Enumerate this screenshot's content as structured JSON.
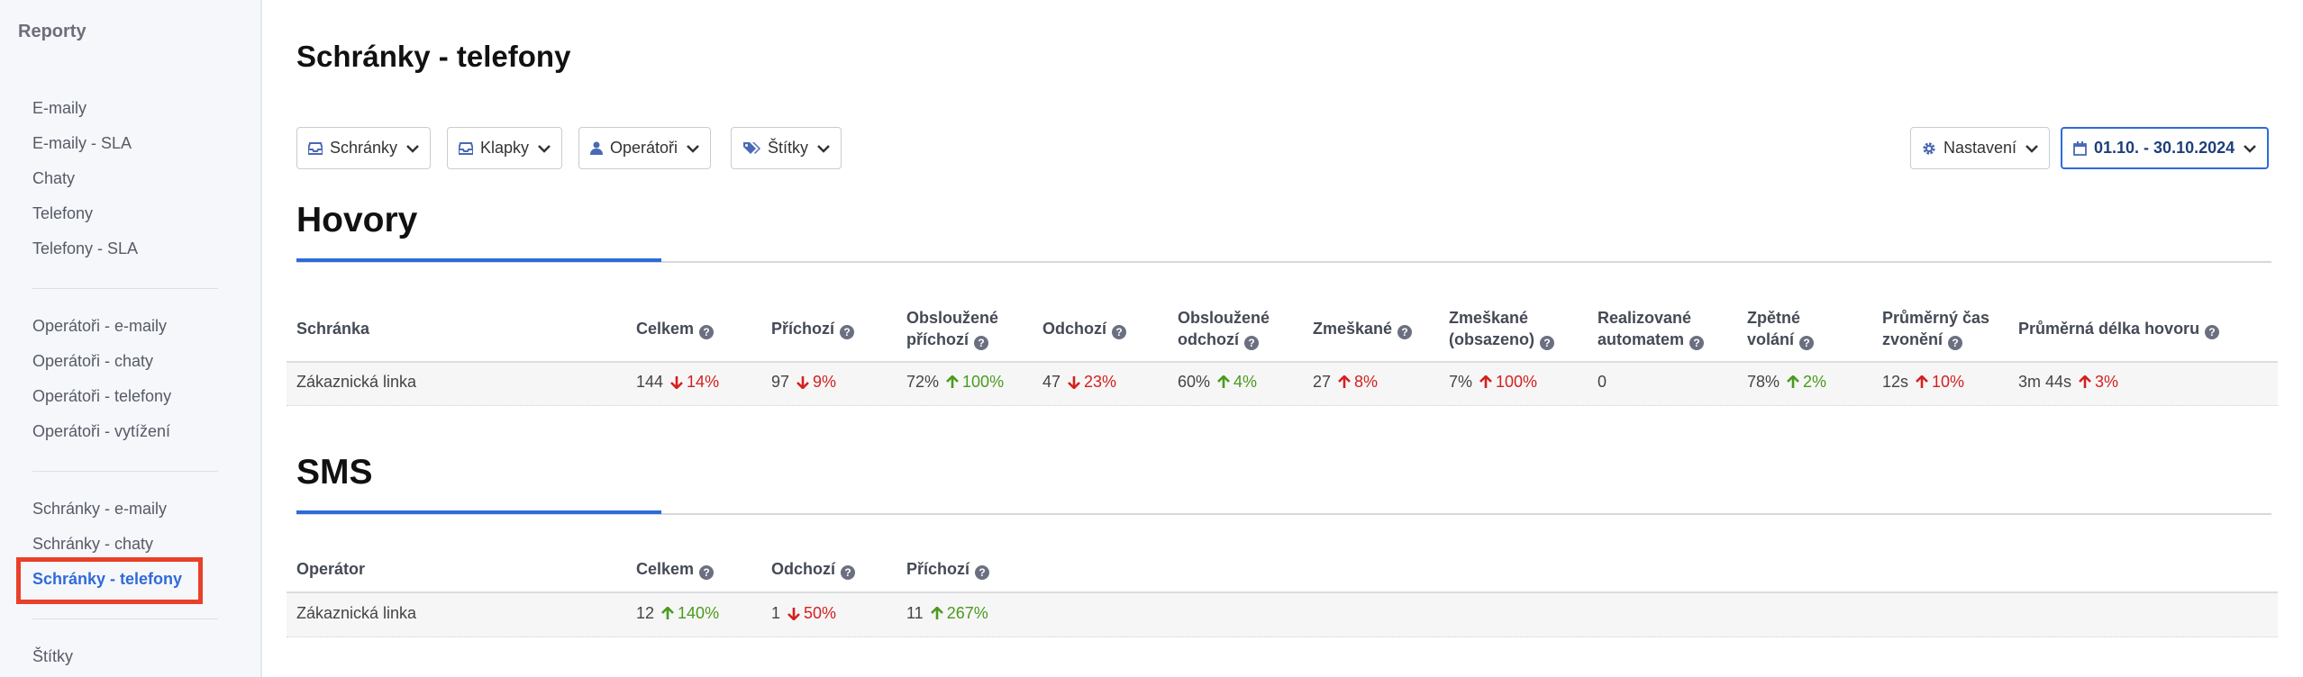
{
  "sidebar": {
    "title": "Reporty",
    "groups": [
      [
        "E-maily",
        "E-maily - SLA",
        "Chaty",
        "Telefony",
        "Telefony - SLA"
      ],
      [
        "Operátoři - e-maily",
        "Operátoři - chaty",
        "Operátoři - telefony",
        "Operátoři - vytížení"
      ],
      [
        "Schránky - e-maily",
        "Schránky - chaty",
        "Schránky - telefony"
      ],
      [
        "Štítky"
      ]
    ],
    "active": "Schránky - telefony"
  },
  "page": {
    "title": "Schránky - telefony"
  },
  "filters": {
    "mailboxes": "Schránky",
    "extensions": "Klapky",
    "operators": "Operátoři",
    "tags": "Štítky",
    "settings": "Nastavení",
    "date_range": "01.10. - 30.10.2024"
  },
  "calls": {
    "title": "Hovory",
    "headers": [
      "Schránka",
      "Celkem",
      "Příchozí",
      "Obsloužené příchozí",
      "Odchozí",
      "Obsloužené odchozí",
      "Zmeškané",
      "Zmeškané (obsazeno)",
      "Realizované automatem",
      "Zpětné volání",
      "Průměrný čas zvonění",
      "Průměrná délka hovoru"
    ],
    "row": {
      "name": "Zákaznická linka",
      "cells": [
        {
          "value": "144",
          "change": "14%",
          "trend": "down"
        },
        {
          "value": "97",
          "change": "9%",
          "trend": "down"
        },
        {
          "value": "72%",
          "change": "100%",
          "trend": "up"
        },
        {
          "value": "47",
          "change": "23%",
          "trend": "down"
        },
        {
          "value": "60%",
          "change": "4%",
          "trend": "up"
        },
        {
          "value": "27",
          "change": "8%",
          "trend": "upbad"
        },
        {
          "value": "7%",
          "change": "100%",
          "trend": "upbad"
        },
        {
          "value": "0",
          "change": "",
          "trend": ""
        },
        {
          "value": "78%",
          "change": "2%",
          "trend": "up"
        },
        {
          "value": "12s",
          "change": "10%",
          "trend": "upbad"
        },
        {
          "value": "3m 44s",
          "change": "3%",
          "trend": "upbad"
        }
      ]
    }
  },
  "sms": {
    "title": "SMS",
    "headers": [
      "Operátor",
      "Celkem",
      "Odchozí",
      "Příchozí"
    ],
    "row": {
      "name": "Zákaznická linka",
      "cells": [
        {
          "value": "12",
          "change": "140%",
          "trend": "up"
        },
        {
          "value": "1",
          "change": "50%",
          "trend": "down"
        },
        {
          "value": "11",
          "change": "267%",
          "trend": "up"
        }
      ]
    }
  },
  "colors": {
    "accent": "#2f6bd8",
    "negative": "#d42020",
    "positive": "#4a9a1e",
    "highlight": "#e8402a"
  }
}
